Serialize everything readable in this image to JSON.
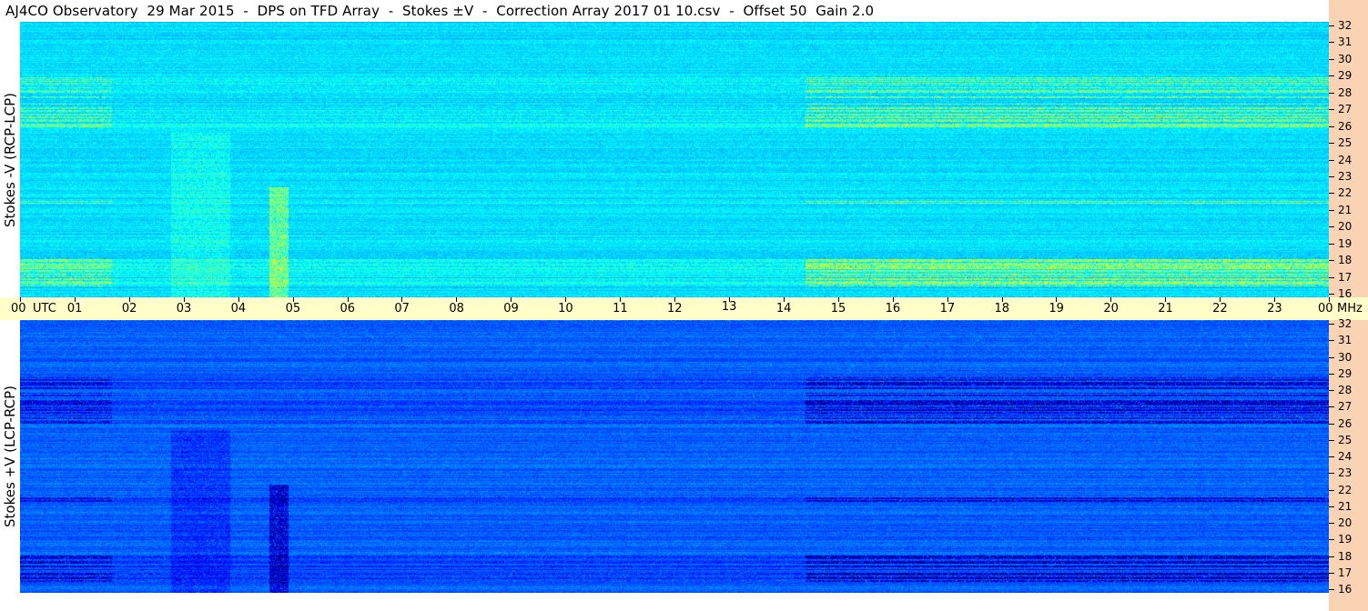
{
  "header": {
    "title": "AJ4CO Observatory  29 Mar 2015  -  DPS on TFD Array  -  Stokes ±V  -  Correction Array 2017 01 10.csv  -  Offset 50  Gain 2.0"
  },
  "chart_data": [
    {
      "type": "heatmap",
      "panel": "top",
      "ylabel": "Stokes -V (RCP-LCP)",
      "y_ticks": [
        16,
        17,
        18,
        19,
        20,
        21,
        22,
        23,
        24,
        25,
        26,
        27,
        28,
        29,
        30,
        31,
        32
      ],
      "ylim": [
        16,
        32
      ],
      "y_unit": "MHz",
      "x_ticks": [
        "00",
        "01",
        "02",
        "03",
        "04",
        "05",
        "06",
        "07",
        "08",
        "09",
        "10",
        "11",
        "12",
        "13",
        "14",
        "15",
        "16",
        "17",
        "18",
        "19",
        "20",
        "21",
        "22",
        "23",
        "00"
      ],
      "x_unit": "UTC",
      "xlim": [
        0,
        24
      ]
    },
    {
      "type": "heatmap",
      "panel": "bottom",
      "ylabel": "Stokes +V (LCP-RCP)",
      "y_ticks": [
        16,
        17,
        18,
        19,
        20,
        21,
        22,
        23,
        24,
        25,
        26,
        27,
        28,
        29,
        30,
        31,
        32
      ],
      "ylim": [
        16,
        32
      ],
      "y_unit": "MHz",
      "x_ticks": [
        "00",
        "01",
        "02",
        "03",
        "04",
        "05",
        "06",
        "07",
        "08",
        "09",
        "10",
        "11",
        "12",
        "13",
        "14",
        "15",
        "16",
        "17",
        "18",
        "19",
        "20",
        "21",
        "22",
        "23",
        "00"
      ],
      "x_unit": "UTC",
      "xlim": [
        0,
        24
      ]
    }
  ],
  "axis": {
    "utc_label": "UTC",
    "mhz_label": "MHz"
  }
}
